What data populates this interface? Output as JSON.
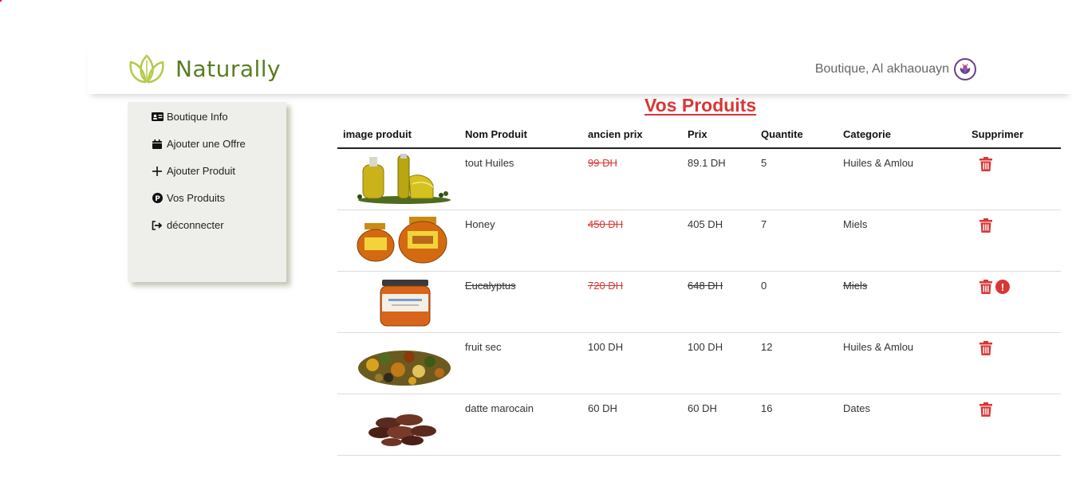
{
  "header": {
    "brand": "Naturally",
    "user_label": "Boutique, Al akhaouayn"
  },
  "sidebar": {
    "items": [
      {
        "label": "Boutique Info",
        "icon": "id-card-icon"
      },
      {
        "label": "Ajouter une Offre",
        "icon": "calendar-icon"
      },
      {
        "label": "Ajouter Produit",
        "icon": "plus-icon"
      },
      {
        "label": "Vos Produits",
        "icon": "product-p-icon"
      },
      {
        "label": "déconnecter",
        "icon": "logout-icon"
      }
    ]
  },
  "main": {
    "title": "Vos Produits",
    "columns": [
      "image produit",
      "Nom Produit",
      "ancien prix",
      "Prix",
      "Quantite",
      "Categorie",
      "Supprimer"
    ],
    "rows": [
      {
        "name": "tout Huiles",
        "old_price": "99 DH",
        "price": "89.1 DH",
        "qty": "5",
        "category": "Huiles & Amlou",
        "image": "oil-bottles",
        "out_of_stock": false,
        "discounted": true
      },
      {
        "name": "Honey",
        "old_price": "450 DH",
        "price": "405 DH",
        "qty": "7",
        "category": "Miels",
        "image": "honey-jars",
        "out_of_stock": false,
        "discounted": true
      },
      {
        "name": "Eucalyptus",
        "old_price": "720 DH",
        "price": "648 DH",
        "qty": "0",
        "category": "Miels",
        "image": "honey-jar-single",
        "out_of_stock": true,
        "discounted": true
      },
      {
        "name": "fruit sec",
        "old_price": "100 DH",
        "price": "100 DH",
        "qty": "12",
        "category": "Huiles & Amlou",
        "image": "dried-fruits",
        "out_of_stock": false,
        "discounted": false
      },
      {
        "name": "datte marocain",
        "old_price": "60 DH",
        "price": "60 DH",
        "qty": "16",
        "category": "Dates",
        "image": "dates",
        "out_of_stock": false,
        "discounted": false
      }
    ]
  },
  "colors": {
    "accent": "#d93636",
    "brand": "#5a7d1e",
    "sidebar_bg": "#eeeeeb"
  }
}
